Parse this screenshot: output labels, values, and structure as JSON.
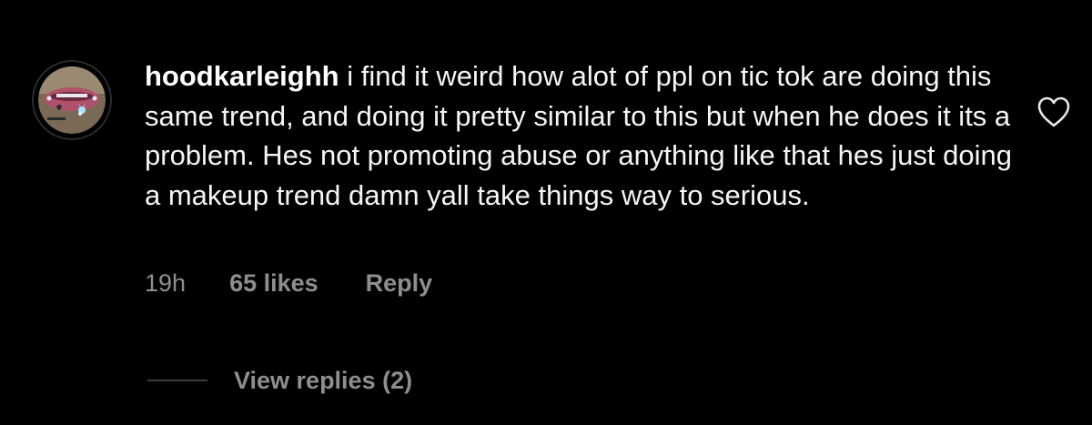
{
  "comment": {
    "avatar_icon": "profile-picture",
    "username": "hoodkarleighh",
    "text": "i find it weird how alot of ppl on tic tok are doing this same trend, and doing it pretty similar to this but when he does it its a problem. Hes not promoting abuse or anything like that hes just doing a makeup trend damn yall take things way to serious.",
    "timestamp": "19h",
    "likes": "65 likes",
    "reply_label": "Reply",
    "like_icon": "heart-outline-icon",
    "view_replies_label": "View replies (2)"
  },
  "colors": {
    "background": "#000000",
    "text": "#f5f5f5",
    "secondary_text": "#8e8e8e",
    "divider": "#3b3b3b"
  }
}
